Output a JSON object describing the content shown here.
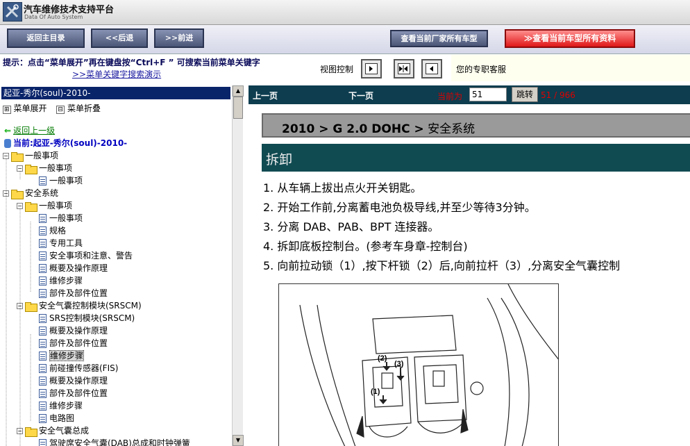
{
  "app": {
    "title": "汽车维修技术支持平台",
    "subtitle": "Data Of Auto System"
  },
  "toolbar": {
    "home": "返回主目录",
    "back": "<<后退",
    "forward": ">>前进",
    "vendor_models": "查看当前厂家所有车型",
    "model_all": "≫查看当前车型所有资料"
  },
  "tip": {
    "text": "提示：点击“菜单展开”再在键盘按“Ctrl+F ” 可搜索当前菜单关键字",
    "link": ">>菜单关键字搜索演示",
    "view_control": "视图控制",
    "contact": "您的专职客服"
  },
  "left": {
    "selected_title": "起亚-秀尔(soul)-2010-",
    "expand_all": "菜单展开",
    "collapse_all": "菜单折叠",
    "back_up": "返回上一级",
    "current": "当前:起亚-秀尔(soul)-2010-",
    "tree": [
      {
        "label": "一般事项",
        "kind": "folder"
      },
      {
        "label": "一般事项",
        "kind": "folder"
      },
      {
        "label": "一般事项",
        "kind": "doc"
      },
      {
        "label": "安全系统",
        "kind": "folder"
      },
      {
        "label": "一般事项",
        "kind": "folder"
      },
      {
        "label": "一般事项",
        "kind": "doc"
      },
      {
        "label": "规格",
        "kind": "doc"
      },
      {
        "label": "专用工具",
        "kind": "doc"
      },
      {
        "label": "安全事项和注意、警告",
        "kind": "doc"
      },
      {
        "label": "概要及操作原理",
        "kind": "doc"
      },
      {
        "label": "维修步骤",
        "kind": "doc"
      },
      {
        "label": "部件及部件位置",
        "kind": "doc"
      },
      {
        "label": "安全气囊控制模块(SRSCM)",
        "kind": "folder"
      },
      {
        "label": "SRS控制模块(SRSCM)",
        "kind": "doc"
      },
      {
        "label": "概要及操作原理",
        "kind": "doc"
      },
      {
        "label": "部件及部件位置",
        "kind": "doc"
      },
      {
        "label": "维修步骤",
        "kind": "doc"
      },
      {
        "label": "前碰撞传感器(FIS)",
        "kind": "doc"
      },
      {
        "label": "概要及操作原理",
        "kind": "doc"
      },
      {
        "label": "部件及部件位置",
        "kind": "doc"
      },
      {
        "label": "维修步骤",
        "kind": "doc"
      },
      {
        "label": "电路图",
        "kind": "doc"
      },
      {
        "label": "安全气囊总成",
        "kind": "folder"
      },
      {
        "label": "驾驶席安全气囊(DAB)总成和时钟弹簧",
        "kind": "doc"
      }
    ]
  },
  "pager": {
    "prev": "上一页",
    "next": "下一页",
    "current_label": "当前为",
    "current_value": "51",
    "jump": "跳转",
    "count": "51 / 966"
  },
  "doc": {
    "path_bold": "2010 > G 2.0 DOHC >",
    "path_rest": " 安全系统",
    "section": "拆卸",
    "steps": [
      "1. 从车辆上拔出点火开关钥匙。",
      "2. 开始工作前,分离蓄电池负极导线,并至少等待3分钟。",
      "3. 分离 DAB、PAB、BPT 连接器。",
      "4. 拆卸底板控制台。(参考车身章-控制台)",
      "5. 向前拉动锁（1）,按下杆锁（2）后,向前拉杆（3）,分离安全气囊控制"
    ],
    "callouts": [
      "(2)",
      "(3)",
      "(1)"
    ]
  }
}
